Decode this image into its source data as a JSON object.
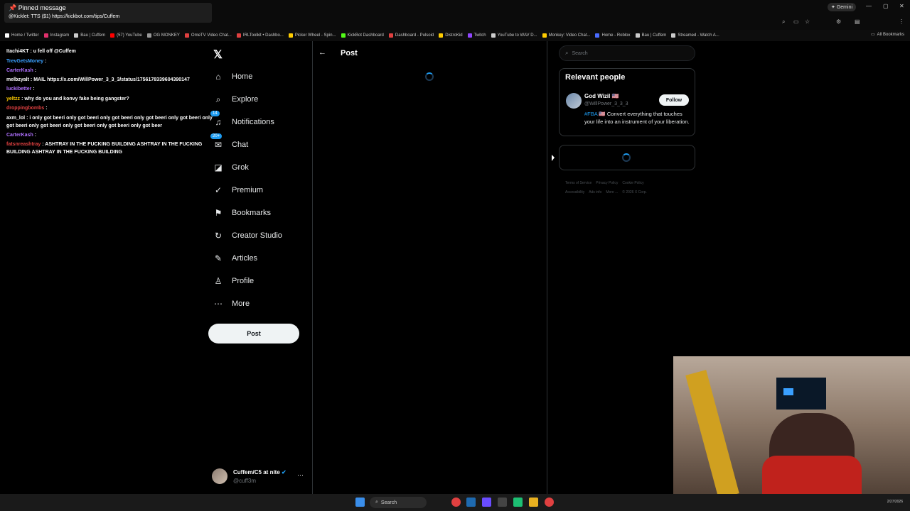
{
  "browser": {
    "gemini_label": "Gemini",
    "bookmarks": [
      {
        "label": "Home / Twitter",
        "color": "#ffffff"
      },
      {
        "label": "Instagram",
        "color": "#e1306c"
      },
      {
        "label": "Bau | Cuffem",
        "color": "#cccccc"
      },
      {
        "label": "(57) YouTube",
        "color": "#ff0000"
      },
      {
        "label": "OG MONKEY",
        "color": "#999999"
      },
      {
        "label": "OmeTV Video Chat...",
        "color": "#e04040"
      },
      {
        "label": "IRLToolkit • Dashbo...",
        "color": "#e04040"
      },
      {
        "label": "Picker Wheel - Spin...",
        "color": "#ffcc00"
      },
      {
        "label": "KickBot Dashboard",
        "color": "#53fc18"
      },
      {
        "label": "Dashboard - Pulsoid",
        "color": "#e04040"
      },
      {
        "label": "DistroKid",
        "color": "#ffcc00"
      },
      {
        "label": "Twitch",
        "color": "#9146ff"
      },
      {
        "label": "YouTube to WAV D...",
        "color": "#cccccc"
      },
      {
        "label": "Monkey: Video Chat...",
        "color": "#ffcc00"
      },
      {
        "label": "Home - Roblox",
        "color": "#4a6cff"
      },
      {
        "label": "Bau | Cuffem",
        "color": "#cccccc"
      },
      {
        "label": "Streamed - Watch A...",
        "color": "#cccccc"
      }
    ],
    "all_bookmarks": "All Bookmarks"
  },
  "chat": {
    "pinned_header": "Pinned message",
    "pinned_text": "@Kicklet: TTS ($1) https://kickbot.com/tips/Cuffem",
    "lines": [
      {
        "user": "Itachi4KT",
        "user_color": "#ffffff",
        "text": "u fell off @Cuffem"
      },
      {
        "user": "TrevGetsMoney",
        "user_color": "#3aa0ff",
        "text": ""
      },
      {
        "user": "CarterKash",
        "user_color": "#b070ff",
        "text": ""
      },
      {
        "user": "melbzyalt",
        "user_color": "#ffffff",
        "text": "MAIL https://x.com/WillPower_3_3_3/status/1756178339604390147"
      },
      {
        "user": "luckibetter",
        "user_color": "#b070ff",
        "text": ""
      },
      {
        "user": "yeltzz",
        "user_color": "#ffcc00",
        "text": "why do you and konvy fake being gangster?"
      },
      {
        "user": "droppingbombs",
        "user_color": "#e04040",
        "text": ""
      },
      {
        "user": "axm_lol",
        "user_color": "#ffffff",
        "text": "i only got beeri only got beeri only got beeri only got beeri only got beeri only got beeri only got beeri only got beeri only got beeri only got beer"
      },
      {
        "user": "CarterKash",
        "user_color": "#b070ff",
        "text": ""
      },
      {
        "user": "fatsnreashtray",
        "user_color": "#e04040",
        "text": "ASHTRAY IN THE FUCKING BUILDING ASHTRAY IN THE FUCKING BUILDING ASHTRAY IN THE FUCKING BUILDING"
      }
    ]
  },
  "nav": {
    "items": [
      {
        "label": "Home",
        "icon": "home-icon",
        "glyph": "⌂"
      },
      {
        "label": "Explore",
        "icon": "search-icon",
        "glyph": "⌕"
      },
      {
        "label": "Notifications",
        "icon": "bell-icon",
        "glyph": "♫",
        "badge": "14"
      },
      {
        "label": "Chat",
        "icon": "mail-icon",
        "glyph": "✉",
        "badge": "20+"
      },
      {
        "label": "Grok",
        "icon": "grok-icon",
        "glyph": "◪"
      },
      {
        "label": "Premium",
        "icon": "premium-icon",
        "glyph": "✓"
      },
      {
        "label": "Bookmarks",
        "icon": "bookmark-icon",
        "glyph": "⚑"
      },
      {
        "label": "Creator Studio",
        "icon": "creator-studio-icon",
        "glyph": "↻"
      },
      {
        "label": "Articles",
        "icon": "articles-icon",
        "glyph": "✎"
      },
      {
        "label": "Profile",
        "icon": "profile-icon",
        "glyph": "♙"
      },
      {
        "label": "More",
        "icon": "more-icon",
        "glyph": "⋯"
      }
    ],
    "post_label": "Post"
  },
  "account": {
    "name": "Cuffem/C5 at nite",
    "handle": "@cuff3m"
  },
  "main": {
    "title": "Post"
  },
  "sidebar": {
    "search_placeholder": "Search",
    "relevant_header": "Relevant people",
    "person": {
      "name": "God Wizil 🇺🇸",
      "handle": "@WillPower_3_3_3",
      "bio_tag": "#FBA",
      "bio_text": " 🇺🇸 Convert everything that touches your life into an instrument of your liberation.",
      "follow_label": "Follow"
    },
    "footer": [
      "Terms of Service",
      "Privacy Policy",
      "Cookie Policy",
      "Accessibility",
      "Ads info",
      "More ...",
      "© 2026 X Corp."
    ]
  },
  "taskbar": {
    "search_label": "Search",
    "clock": "2/27/2026"
  }
}
